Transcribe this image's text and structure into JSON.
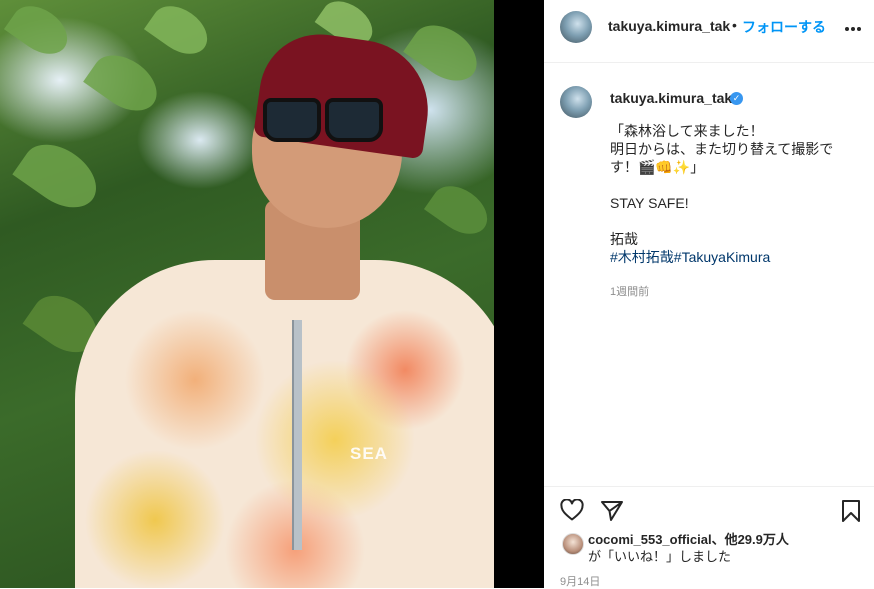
{
  "post": {
    "username": "takuya.kimura_tak",
    "follow_label": "フォローする",
    "separator": "•",
    "more_label": "•••",
    "verified_icon": "check-badge-icon",
    "caption_lines": [
      "「森林浴して来ました！",
      "明日からは、また切り替えて撮影です！🎬👊✨」",
      "STAY SAFE!",
      "拓哉"
    ],
    "hashtags": [
      "#木村拓哉",
      "#TakuyaKimura"
    ],
    "relative_time": "1週間前",
    "photo_print": "SEA"
  },
  "likes": {
    "first_user": "cocomi_553_official",
    "others": "、他29.9万人",
    "suffix": "が「いいね！」しました"
  },
  "date": "9月14日",
  "colors": {
    "accent": "#0095f6",
    "text": "#262626",
    "muted": "#8e8e8e",
    "hashtag": "#00376b"
  }
}
